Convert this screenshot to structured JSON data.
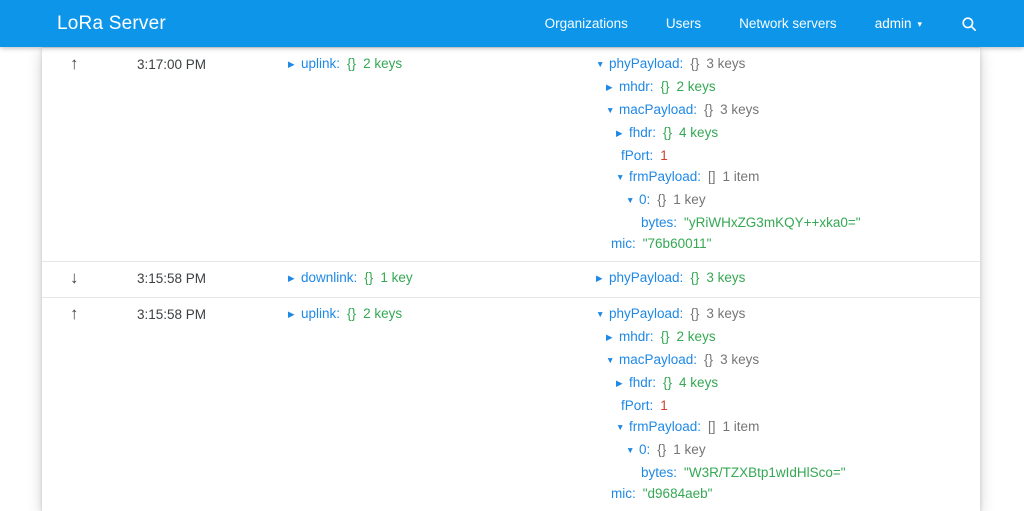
{
  "header": {
    "title": "LoRa Server",
    "nav": [
      {
        "id": "organizations",
        "label": "Organizations"
      },
      {
        "id": "users",
        "label": "Users"
      },
      {
        "id": "network-servers",
        "label": "Network servers"
      }
    ],
    "user_menu": {
      "label": "admin",
      "icon": "chevron-down-icon"
    },
    "search": {
      "icon": "search-icon"
    }
  },
  "colors": {
    "header_bg": "#0d96e9",
    "key_blue": "#1e88e5",
    "collapsed_green": "#34a853",
    "expanded_gray": "#757575",
    "number_red": "#d23f31",
    "string_green": "#34a853",
    "icon_dark": "#424242",
    "divider": "#e6e6e6"
  },
  "log_rows": [
    {
      "direction": "up",
      "time": "3:17:00 PM",
      "summary": {
        "indent": 0,
        "state": "closed",
        "key": "uplink",
        "brace": "{}",
        "count": "2 keys"
      },
      "payload": [
        {
          "indent": 0,
          "state": "open",
          "key": "phyPayload",
          "brace": "{}",
          "count": "3 keys"
        },
        {
          "indent": 1,
          "state": "closed",
          "key": "mhdr",
          "brace": "{}",
          "count": "2 keys"
        },
        {
          "indent": 1,
          "state": "open",
          "key": "macPayload",
          "brace": "{}",
          "count": "3 keys"
        },
        {
          "indent": 2,
          "state": "closed",
          "key": "fhdr",
          "brace": "{}",
          "count": "4 keys"
        },
        {
          "indent": 2,
          "state": "leaf",
          "key": "fPort",
          "value": "1",
          "value_type": "number"
        },
        {
          "indent": 2,
          "state": "open",
          "key": "frmPayload",
          "brace": "[]",
          "count": "1 item"
        },
        {
          "indent": 3,
          "state": "open",
          "key": "0",
          "brace": "{}",
          "count": "1 key"
        },
        {
          "indent": 4,
          "state": "leaf",
          "key": "bytes",
          "value": "yRiWHxZG3mKQY++xka0=",
          "value_type": "string"
        },
        {
          "indent": 1,
          "state": "leaf",
          "key": "mic",
          "value": "76b60011",
          "value_type": "string"
        }
      ]
    },
    {
      "direction": "down",
      "time": "3:15:58 PM",
      "summary": {
        "indent": 0,
        "state": "closed",
        "key": "downlink",
        "brace": "{}",
        "count": "1 key"
      },
      "payload": [
        {
          "indent": 0,
          "state": "closed",
          "key": "phyPayload",
          "brace": "{}",
          "count": "3 keys"
        }
      ]
    },
    {
      "direction": "up",
      "time": "3:15:58 PM",
      "summary": {
        "indent": 0,
        "state": "closed",
        "key": "uplink",
        "brace": "{}",
        "count": "2 keys"
      },
      "payload": [
        {
          "indent": 0,
          "state": "open",
          "key": "phyPayload",
          "brace": "{}",
          "count": "3 keys"
        },
        {
          "indent": 1,
          "state": "closed",
          "key": "mhdr",
          "brace": "{}",
          "count": "2 keys"
        },
        {
          "indent": 1,
          "state": "open",
          "key": "macPayload",
          "brace": "{}",
          "count": "3 keys"
        },
        {
          "indent": 2,
          "state": "closed",
          "key": "fhdr",
          "brace": "{}",
          "count": "4 keys"
        },
        {
          "indent": 2,
          "state": "leaf",
          "key": "fPort",
          "value": "1",
          "value_type": "number"
        },
        {
          "indent": 2,
          "state": "open",
          "key": "frmPayload",
          "brace": "[]",
          "count": "1 item"
        },
        {
          "indent": 3,
          "state": "open",
          "key": "0",
          "brace": "{}",
          "count": "1 key"
        },
        {
          "indent": 4,
          "state": "leaf",
          "key": "bytes",
          "value": "W3R/TZXBtp1wIdHlSco=",
          "value_type": "string"
        },
        {
          "indent": 1,
          "state": "leaf",
          "key": "mic",
          "value": "d9684aeb",
          "value_type": "string"
        }
      ]
    }
  ],
  "icons": {
    "up_glyph": "↑",
    "down_glyph": "↓",
    "expanded_glyph": "▼",
    "collapsed_glyph": "▶",
    "caret_glyph": "▾"
  }
}
